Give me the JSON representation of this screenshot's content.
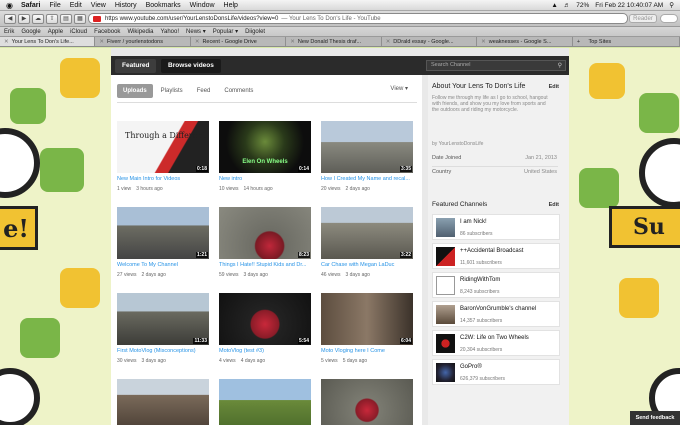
{
  "menubar": {
    "apple": "",
    "items": [
      "Safari",
      "File",
      "Edit",
      "View",
      "History",
      "Bookmarks",
      "Window",
      "Help"
    ],
    "battery": "72%",
    "clock": "Fri Feb 22  10:40:07 AM"
  },
  "toolbar": {
    "url": "https www.youtube.com/user/YourLenstoDonsLife/videos?view=0",
    "page_title": "— Your Lens To Don's Life - YouTube",
    "reader_label": "Reader"
  },
  "bookmarks": [
    "Erik",
    "Google",
    "Apple",
    "iCloud",
    "Facebook",
    "Wikipedia",
    "Yahoo!",
    "News ▾",
    "Popular ▾",
    "Diigolet"
  ],
  "tabs": [
    {
      "label": "Your Lens To Don's Life...",
      "active": true
    },
    {
      "label": "Fiverr / yourlenstodons",
      "active": false
    },
    {
      "label": "Recent - Google Drive",
      "active": false
    },
    {
      "label": "New Donald Thesis draf...",
      "active": false
    },
    {
      "label": "DDrald essay - Google...",
      "active": false
    },
    {
      "label": "weaknesses - Google S...",
      "active": false
    },
    {
      "label": "Top Sites",
      "active": false
    }
  ],
  "channel_nav": {
    "featured": "Featured",
    "browse": "Browse videos",
    "search_placeholder": "Search Channel"
  },
  "filters": {
    "uploads": "Uploads",
    "playlists": "Playlists",
    "feed": "Feed",
    "comments": "Comments",
    "view": "View ▾"
  },
  "videos": [
    {
      "title": "New Main Intro for Videos",
      "views": "1 view",
      "age": "3 hours ago",
      "duration": "0:18",
      "thumb_text": "Through a Different"
    },
    {
      "title": "New intro",
      "views": "10 views",
      "age": "14 hours ago",
      "duration": "0:14",
      "thumb_text": "Elen On Wheels"
    },
    {
      "title": "How I Created My Name and recal...",
      "views": "20 views",
      "age": "2 days ago",
      "duration": "3:35",
      "thumb_text": ""
    },
    {
      "title": "Welcome To My Channel",
      "views": "27 views",
      "age": "2 days ago",
      "duration": "1:21",
      "thumb_text": ""
    },
    {
      "title": "Things I Hate!! Stupid Kids and Dr...",
      "views": "59 views",
      "age": "3 days ago",
      "duration": "8:23",
      "thumb_text": ""
    },
    {
      "title": "Car Chase with Megan LaDuc",
      "views": "46 views",
      "age": "3 days ago",
      "duration": "3:22",
      "thumb_text": ""
    },
    {
      "title": "First MotoVlog (Misconceptions)",
      "views": "30 views",
      "age": "3 days ago",
      "duration": "11:33",
      "thumb_text": ""
    },
    {
      "title": "MotoVlog (test #3)",
      "views": "4 views",
      "age": "4 days ago",
      "duration": "5:54",
      "thumb_text": ""
    },
    {
      "title": "Moto Vloging here I Come",
      "views": "5 views",
      "age": "5 days ago",
      "duration": "6:04",
      "thumb_text": ""
    },
    {
      "title": "",
      "views": "",
      "age": "",
      "duration": "",
      "thumb_text": ""
    },
    {
      "title": "",
      "views": "",
      "age": "",
      "duration": "",
      "thumb_text": ""
    },
    {
      "title": "",
      "views": "",
      "age": "",
      "duration": "",
      "thumb_text": ""
    }
  ],
  "about": {
    "heading": "About Your Lens To Don's Life",
    "edit": "Edit",
    "description": "Follow me through my life as I go to school, hangout with friends, and show you my love from sports and the outdoors and riding my motorcycle.",
    "byline": "by YourLenstoDonsLife",
    "date_joined_label": "Date Joined",
    "date_joined": "Jan 21, 2013",
    "country_label": "Country",
    "country": "United States"
  },
  "featured_channels": {
    "heading": "Featured Channels",
    "edit": "Edit",
    "items": [
      {
        "name": "I am Nick!",
        "subs": "86 subscribers"
      },
      {
        "name": "++Accidental Broadcast",
        "subs": "11,601 subscribers"
      },
      {
        "name": "RidingWithTom",
        "subs": "8,243 subscribers"
      },
      {
        "name": "BaronVonGrumble's channel",
        "subs": "14,357 subscribers"
      },
      {
        "name": "C2W: Life on Two Wheels",
        "subs": "20,304 subscribers"
      },
      {
        "name": "GoPro®",
        "subs": "626,379 subscribers"
      }
    ]
  },
  "feedback": "Send feedback",
  "bg_sign_left": "e!",
  "bg_sign_right": "Su",
  "colors": {
    "link": "#2793e6",
    "nav_dark": "#2b2b2b",
    "page_bg": "#e9e9e9"
  }
}
